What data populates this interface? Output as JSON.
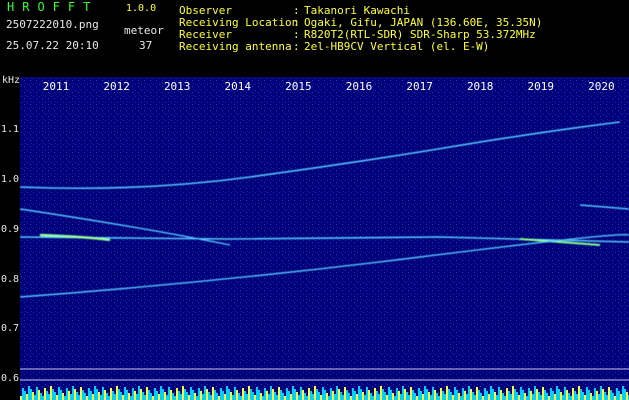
{
  "header": {
    "app_title": "HROFFT",
    "app_version": "1.0.0",
    "filename": "2507222010.png",
    "datetime": "25.07.22 20:10",
    "meteor_label": "meteor",
    "meteor_count": "37",
    "info": [
      {
        "label": "Observer",
        "value": "Takanori Kawachi"
      },
      {
        "label": "Receiving Location",
        "value": "Ogaki, Gifu, JAPAN (136.60E, 35.35N)"
      },
      {
        "label": "Receiver",
        "value": "R820T2(RTL-SDR) SDR-Sharp 53.372MHz"
      },
      {
        "label": "Receiving antenna",
        "value": "2el-HB9CV Vertical (el. E-W)"
      }
    ]
  },
  "spectrogram": {
    "unit_label": "kHz",
    "time_labels": [
      "2011",
      "2012",
      "2013",
      "2014",
      "2015",
      "2016",
      "2017",
      "2018",
      "2019",
      "2020"
    ],
    "freq_labels": [
      "1.1",
      "1.0",
      "0.9",
      "0.8",
      "0.7",
      "0.6"
    ],
    "background_color": "#00007a",
    "trace_color": "#55c8ff"
  }
}
